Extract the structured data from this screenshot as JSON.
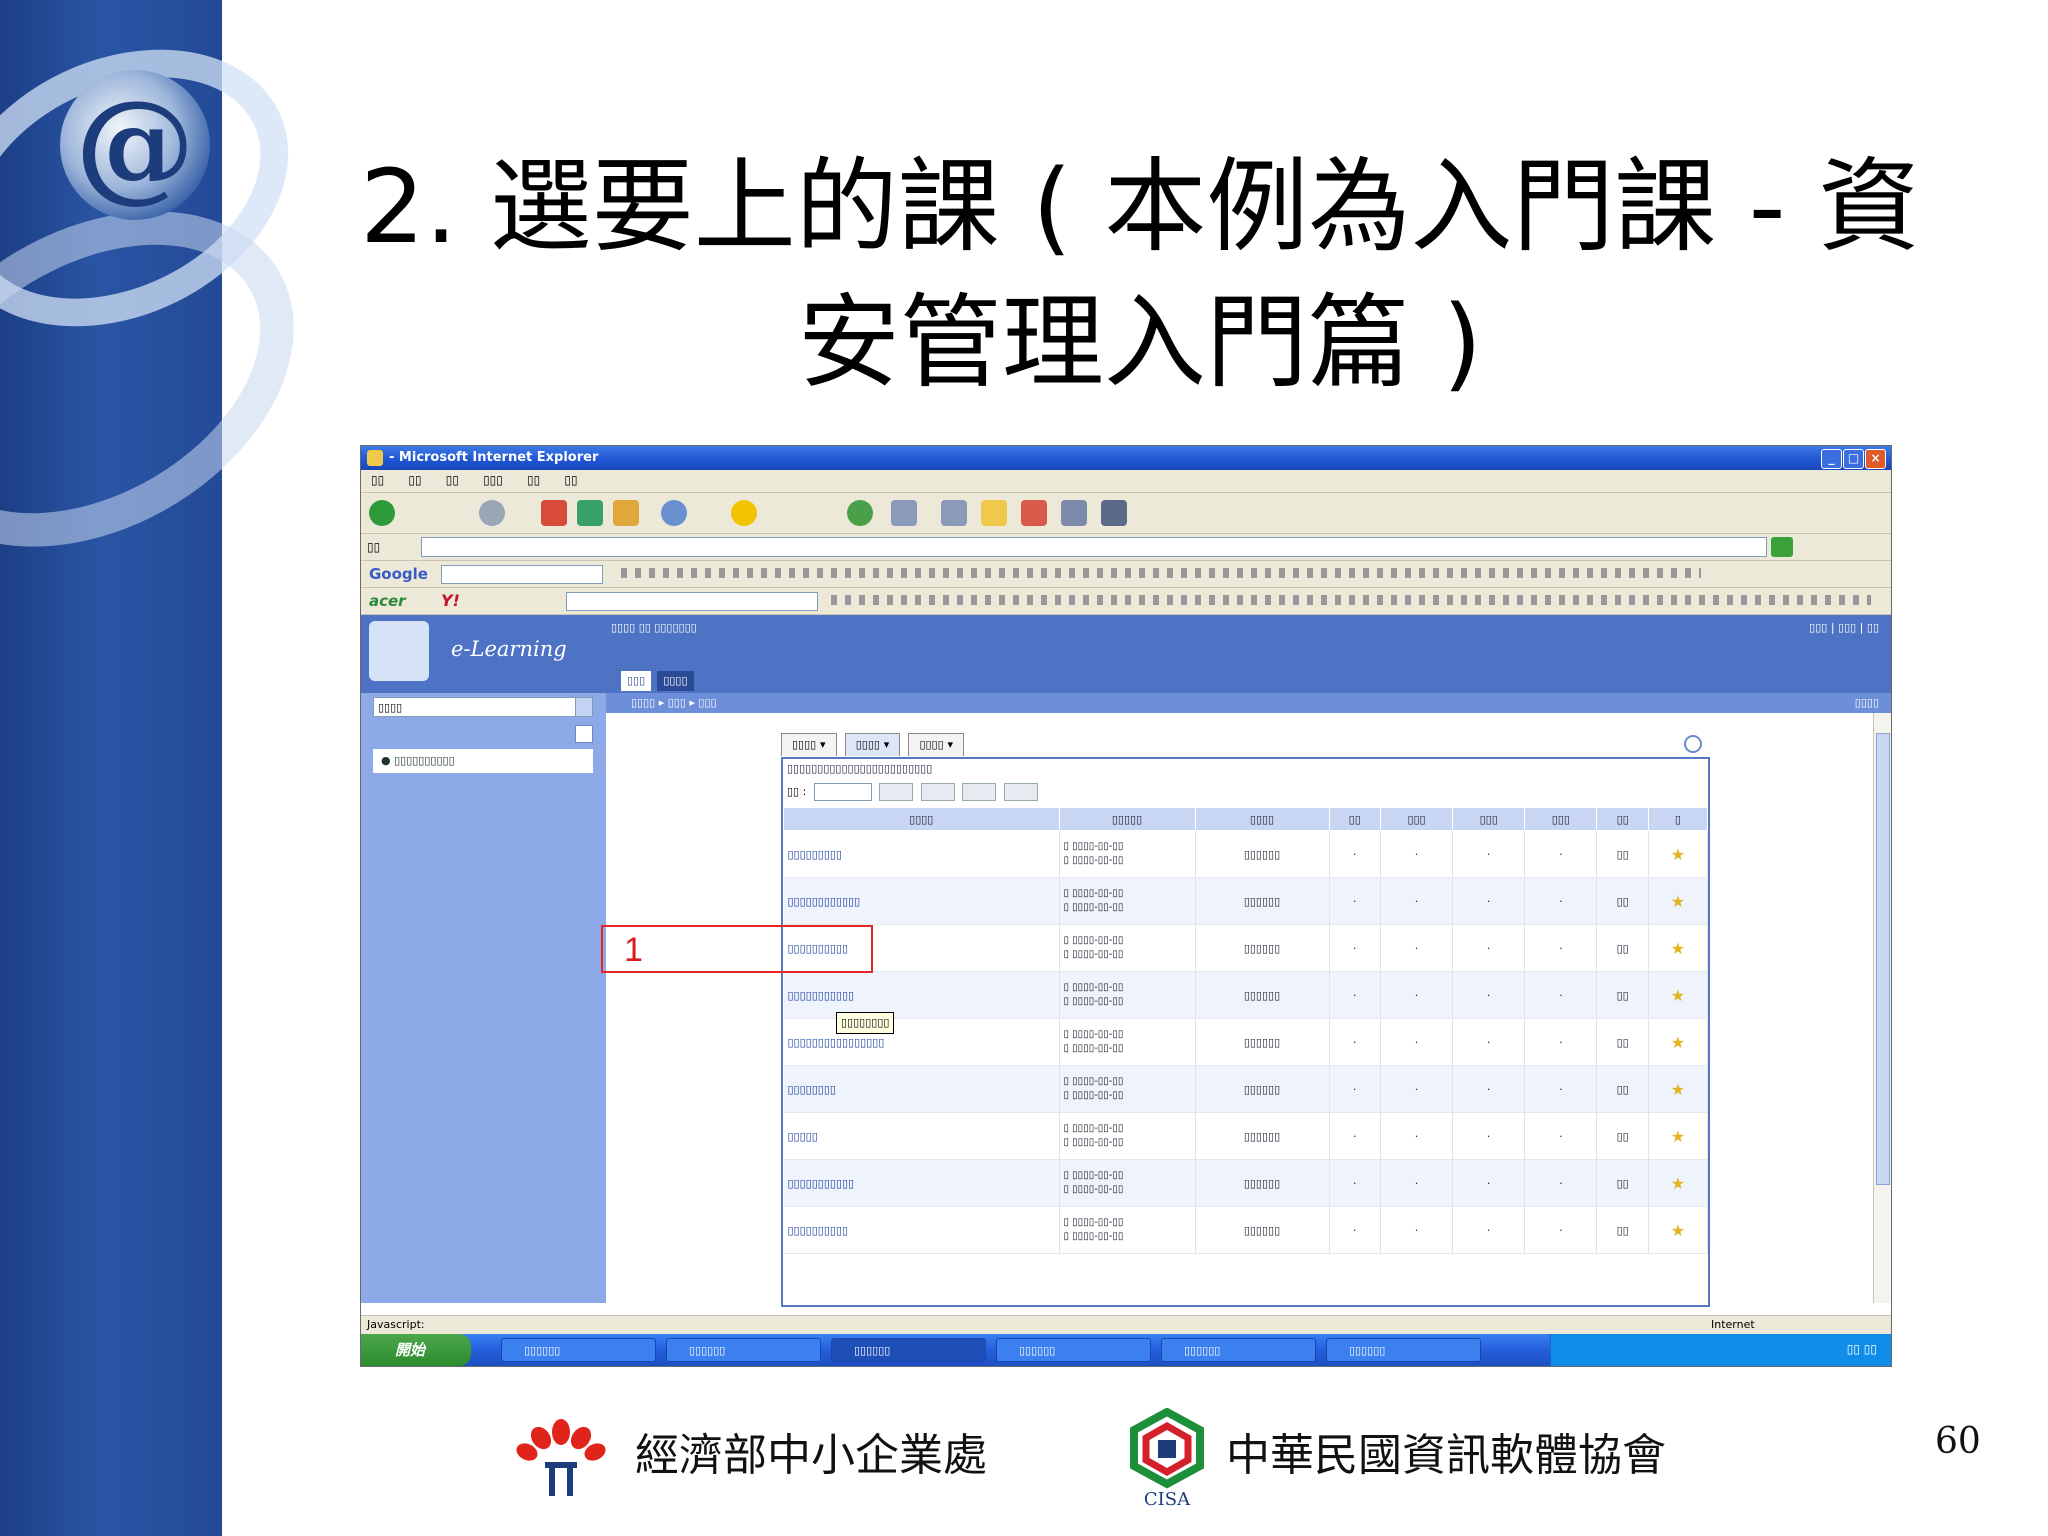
{
  "slide": {
    "title_line1": "2. 選要上的課 ( 本例為入門課 - 資",
    "title_line2": "安管理入門篇 )",
    "page_number": "60"
  },
  "footer": {
    "org1": "經濟部中小企業處",
    "org2": "中華民國資訊軟體協會",
    "org2_abbr": "CISA"
  },
  "callout": {
    "number": "1"
  },
  "browser": {
    "app_name": "e-Learning",
    "title_suffix": "- Microsoft Internet Explorer",
    "status_left": "Javascript:",
    "status_right": "Internet",
    "search_brand": "Google",
    "acer_brand": "acer",
    "yahoo_brand": "Y!",
    "start_label": "開始"
  },
  "colors": {
    "banner": "#4e73c5",
    "sidebar": "#8ea9e8",
    "callout": "#e32626",
    "title_bar": "#1f54d2"
  }
}
